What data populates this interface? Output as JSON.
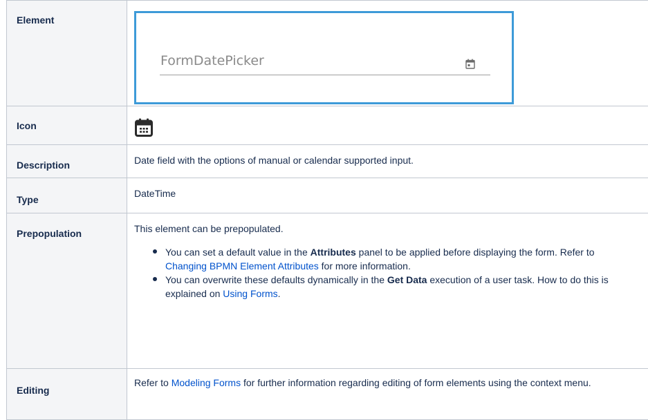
{
  "rows": {
    "element": {
      "header": "Element",
      "preview_placeholder": "FormDatePicker",
      "preview_icon": "calendar-icon"
    },
    "icon": {
      "header": "Icon",
      "icon": "calendar-grid-icon"
    },
    "description": {
      "header": "Description",
      "text": "Date field with the options of manual or calendar supported input."
    },
    "type": {
      "header": "Type",
      "text": "DateTime"
    },
    "prepopulation": {
      "header": "Prepopulation",
      "intro": "This element can be prepopulated.",
      "bullet1": {
        "pre": "You can set a default value in the ",
        "bold": "Attributes",
        "mid": " panel to be applied before displaying the form. Refer to ",
        "link": "Changing BPMN Element Attributes",
        "post": " for more information."
      },
      "bullet2": {
        "pre": "You can overwrite these defaults dynamically in the ",
        "bold": "Get Data",
        "mid": " execution of a user task. How to do this is explained on ",
        "link": "Using Forms",
        "post": "."
      }
    },
    "editing": {
      "header": "Editing",
      "pre": "Refer to ",
      "link": "Modeling Forms",
      "post": " for further information regarding editing of form elements using the context menu."
    }
  },
  "colors": {
    "preview_border": "#3d9ad8",
    "link": "#0052cc",
    "header_bg": "#f4f5f7",
    "text": "#172b4d"
  }
}
